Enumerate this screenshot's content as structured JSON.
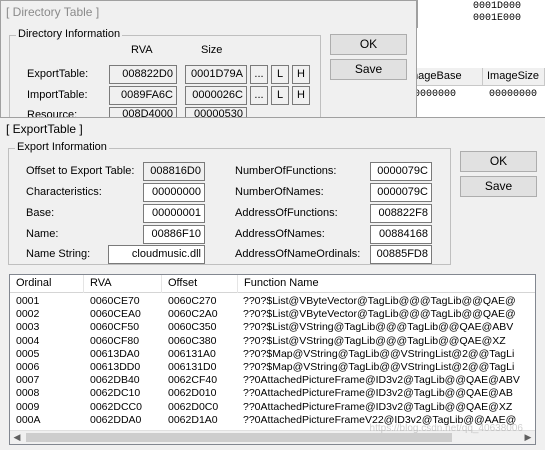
{
  "background_window": {
    "top_values": [
      "0001D000",
      "0001E000"
    ],
    "table_headers": [
      "mageBase",
      "ImageSize"
    ],
    "table_values": [
      "00000000",
      "00000000"
    ]
  },
  "directory_window": {
    "title": "[ Directory Table ]",
    "group_label": "Directory Information",
    "col_rva": "RVA",
    "col_size": "Size",
    "rows": [
      {
        "label": "ExportTable:",
        "rva": "008822D0",
        "size": "0001D79A"
      },
      {
        "label": "ImportTable:",
        "rva": "0089FA6C",
        "size": "0000026C"
      },
      {
        "label": "Resource:",
        "rva": "008D4000",
        "size": "00000530"
      }
    ],
    "btn_dots": "...",
    "btn_l": "L",
    "btn_h": "H",
    "ok_label": "OK",
    "save_label": "Save"
  },
  "export_window": {
    "title": "[ ExportTable ]",
    "group_label": "Export Information",
    "ok_label": "OK",
    "save_label": "Save",
    "left_fields": [
      {
        "label": "Offset to Export Table:",
        "value": "008816D0"
      },
      {
        "label": "Characteristics:",
        "value": "00000000"
      },
      {
        "label": "Base:",
        "value": "00000001"
      },
      {
        "label": "Name:",
        "value": "00886F10"
      },
      {
        "label": "Name String:",
        "value": "cloudmusic.dll"
      }
    ],
    "right_fields": [
      {
        "label": "NumberOfFunctions:",
        "value": "0000079C"
      },
      {
        "label": "NumberOfNames:",
        "value": "0000079C"
      },
      {
        "label": "AddressOfFunctions:",
        "value": "008822F8"
      },
      {
        "label": "AddressOfNames:",
        "value": "00884168"
      },
      {
        "label": "AddressOfNameOrdinals:",
        "value": "00885FD8"
      }
    ],
    "table_headers": [
      "Ordinal",
      "RVA",
      "Offset",
      "Function Name"
    ],
    "table_rows": [
      [
        "0001",
        "0060CE70",
        "0060C270",
        "??0?$List@VByteVector@TagLib@@@TagLib@@QAE@"
      ],
      [
        "0002",
        "0060CEA0",
        "0060C2A0",
        "??0?$List@VByteVector@TagLib@@@TagLib@@QAE@"
      ],
      [
        "0003",
        "0060CF50",
        "0060C350",
        "??0?$List@VString@TagLib@@@TagLib@@QAE@ABV"
      ],
      [
        "0004",
        "0060CF80",
        "0060C380",
        "??0?$List@VString@TagLib@@@TagLib@@QAE@XZ"
      ],
      [
        "0005",
        "00613DA0",
        "006131A0",
        "??0?$Map@VString@TagLib@@VStringList@2@@TagLi"
      ],
      [
        "0006",
        "00613DD0",
        "006131D0",
        "??0?$Map@VString@TagLib@@VStringList@2@@TagLi"
      ],
      [
        "0007",
        "0062DB40",
        "0062CF40",
        "??0AttachedPictureFrame@ID3v2@TagLib@@QAE@ABV"
      ],
      [
        "0008",
        "0062DC10",
        "0062D010",
        "??0AttachedPictureFrame@ID3v2@TagLib@@QAE@AB"
      ],
      [
        "0009",
        "0062DCC0",
        "0062D0C0",
        "??0AttachedPictureFrame@ID3v2@TagLib@@QAE@XZ"
      ],
      [
        "000A",
        "0062DDA0",
        "0062D1A0",
        "??0AttachedPictureFrameV22@ID3v2@TagLib@@AAE@"
      ]
    ],
    "watermark": "https://blog.csdn.net/qq_40638006"
  }
}
